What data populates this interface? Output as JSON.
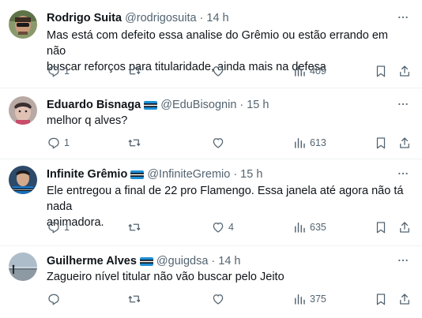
{
  "tweets": [
    {
      "name": "Rodrigo Suita",
      "handle": "@rodrigosuita",
      "time": "14 h",
      "has_flag": false,
      "lines": [
        "Mas está com defeito essa analise do Grêmio ou estão errando em não",
        "buscar reforços para titularidade, ainda mais na defesa"
      ],
      "replies": "1",
      "retweets": "",
      "likes": "",
      "views": "409"
    },
    {
      "name": "Eduardo Bisnaga",
      "handle": "@EduBisognin",
      "time": "15 h",
      "has_flag": true,
      "lines": [
        "melhor q alves?"
      ],
      "replies": "1",
      "retweets": "",
      "likes": "",
      "views": "613"
    },
    {
      "name": "Infinite Grêmio",
      "handle": "@InfiniteGremio",
      "time": "15 h",
      "has_flag": true,
      "lines": [
        "Ele entregou a final de 22 pro Flamengo. Essa janela até agora não tá nada",
        "animadora."
      ],
      "replies": "1",
      "retweets": "",
      "likes": "4",
      "views": "635"
    },
    {
      "name": "Guilherme Alves",
      "handle": "@guigdsa",
      "time": "14 h",
      "has_flag": true,
      "lines": [
        "Zagueiro nível titular não vão buscar pelo Jeito"
      ],
      "replies": "",
      "retweets": "",
      "likes": "",
      "views": "375"
    }
  ],
  "separator": "·",
  "icons": {
    "more": "more-horizontal-icon",
    "reply": "reply-icon",
    "retweet": "retweet-icon",
    "like": "heart-icon",
    "views": "analytics-bars-icon",
    "bookmark": "bookmark-icon",
    "share": "share-icon",
    "flag": "gremio-flag-icon"
  },
  "colors": {
    "text": "#0f1419",
    "secondary": "#536471",
    "divider": "#eff3f4",
    "flag_blue": "#1f8fd6",
    "flag_black": "#000000"
  }
}
